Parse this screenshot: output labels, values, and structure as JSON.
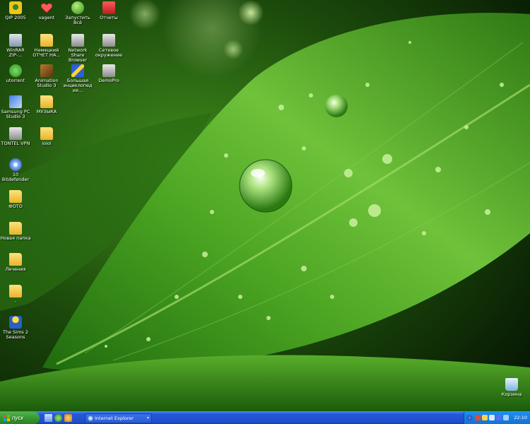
{
  "desktop": {
    "icons": [
      {
        "id": "qip",
        "label": "QIP 2005",
        "icon": "qip-icon"
      },
      {
        "id": "vagent",
        "label": "vagent",
        "icon": "heart-icon"
      },
      {
        "id": "green-app",
        "label": "Запустить Всё",
        "icon": "green-ball-icon"
      },
      {
        "id": "red-app",
        "label": "Отчеты",
        "icon": "red-app-icon"
      },
      {
        "id": "hdd",
        "label": "WinRAR ZIP-...",
        "icon": "drive-icon"
      },
      {
        "id": "folder-1",
        "label": "Немецкий ОТЧЕТ НА...",
        "icon": "folder-icon"
      },
      {
        "id": "net-browser",
        "label": "Network Share Browser",
        "icon": "network-icon"
      },
      {
        "id": "remote",
        "label": "Сетевое окружение",
        "icon": "computer-icon"
      },
      {
        "id": "utorrent",
        "label": "utorrent",
        "icon": "utorrent-icon"
      },
      {
        "id": "animation",
        "label": "Animation Studio 3",
        "icon": "animation-icon"
      },
      {
        "id": "big-app",
        "label": "Большая энциклопедия...",
        "icon": "scanner-icon"
      },
      {
        "id": "demopro",
        "label": "DemoPro",
        "icon": "computer-icon"
      },
      {
        "id": "samsung",
        "label": "Samsung PC Studio 3",
        "icon": "tool-icon"
      },
      {
        "id": "muzika",
        "label": "МУЗЫКА",
        "icon": "folder-icon"
      },
      {
        "id": "tontel",
        "label": "TONTEL VPN",
        "icon": "vpn-icon"
      },
      {
        "id": "ioioi",
        "label": "ioioi",
        "icon": "folder-icon"
      },
      {
        "id": "bitdefender",
        "label": "10 Bitdefender",
        "icon": "disc-icon"
      },
      {
        "id": "foto",
        "label": "ФОТО",
        "icon": "folder-icon"
      },
      {
        "id": "nova-papka",
        "label": "Новая папка",
        "icon": "folder-icon"
      },
      {
        "id": "lecheniya",
        "label": "Лечения",
        "icon": "folder-icon"
      },
      {
        "id": "empty-folder",
        "label": "-",
        "icon": "folder-icon"
      },
      {
        "id": "sims2",
        "label": "The Sims 2 Seasons",
        "icon": "sims-icon"
      },
      {
        "id": "recycle",
        "label": "Корзина",
        "icon": "recycle-bin-icon"
      }
    ]
  },
  "taskbar": {
    "start_label": "пуск",
    "quick_launch": [
      "desktop-icon",
      "ie-icon",
      "media-icon"
    ],
    "active_task": {
      "label": "Internet Explorer",
      "icon": "ie-icon"
    },
    "tray_icons": [
      "shield-icon",
      "network-icon",
      "volume-icon",
      "antivirus-icon",
      "language-icon"
    ],
    "clock": "22:10"
  },
  "colors": {
    "taskbar": "#2457d6",
    "start": "#379a2f",
    "tray": "#1571d3"
  }
}
